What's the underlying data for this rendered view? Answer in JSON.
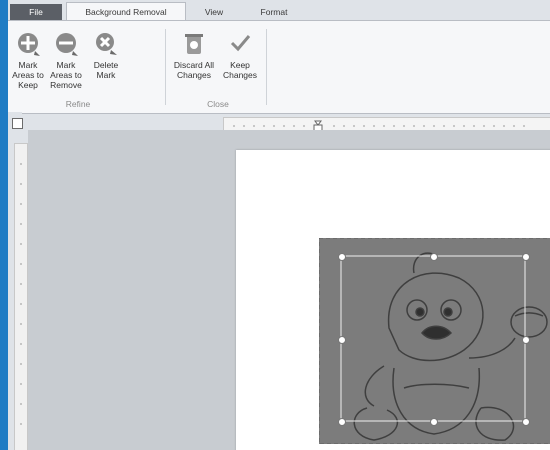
{
  "ribbon": {
    "tabs": [
      {
        "label": "File",
        "state": "file"
      },
      {
        "label": "Background Removal",
        "state": "active"
      },
      {
        "label": "View",
        "state": "normal"
      },
      {
        "label": "Format",
        "state": "normal"
      }
    ],
    "buttons": [
      {
        "label": "Mark Areas to Keep",
        "icon": "plus-pencil-icon"
      },
      {
        "label": "Mark Areas to Remove",
        "icon": "minus-pencil-icon"
      },
      {
        "label": "Delete Mark",
        "icon": "delete-mark-icon"
      },
      {
        "label": "Discard All Changes",
        "icon": "discard-icon"
      },
      {
        "label": "Keep Changes",
        "icon": "checkmark-icon"
      }
    ],
    "groups": [
      "Refine",
      "Close"
    ]
  },
  "colors": {
    "accent": "#1f7cc4",
    "ribbon_bg": "#f6f7f9",
    "canvas_bg": "#c8ccd1",
    "image_gray": "#7a7a7a"
  }
}
